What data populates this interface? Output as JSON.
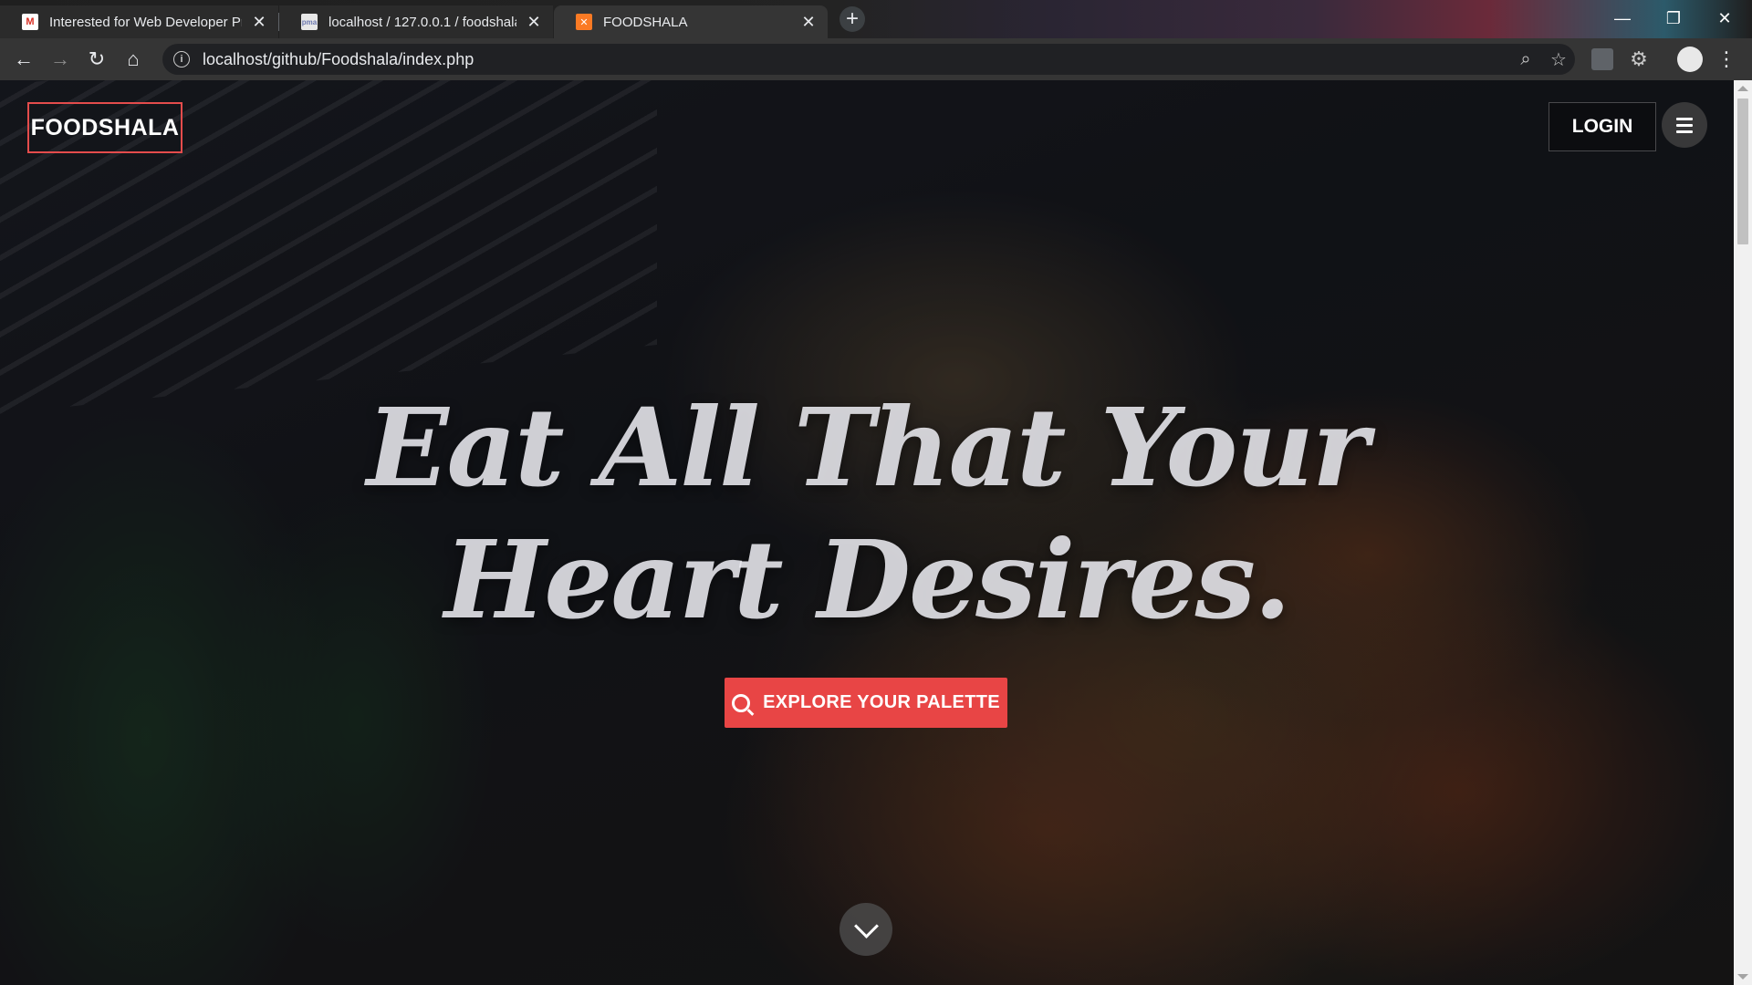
{
  "browser": {
    "tabs": [
      {
        "title": "Interested for Web Developer Pr",
        "favicon": "gmail-icon",
        "active": false
      },
      {
        "title": "localhost / 127.0.0.1 / foodshala",
        "favicon": "phpmyadmin-icon",
        "active": false
      },
      {
        "title": "FOODSHALA",
        "favicon": "xampp-icon",
        "active": true
      }
    ],
    "new_tab": "+",
    "address": "localhost/github/Foodshala/index.php",
    "window_controls": {
      "minimize": "—",
      "restore": "❐",
      "close": "✕"
    }
  },
  "site": {
    "brand": "FOODSHALA",
    "login_label": "LOGIN",
    "headline_line1": "Eat All That Your",
    "headline_line2": "Heart Desires.",
    "cta_label": "EXPLORE YOUR PALETTE"
  },
  "colors": {
    "accent": "#e84545",
    "brand_border": "#e44c4c",
    "chrome_bg": "#353535"
  }
}
